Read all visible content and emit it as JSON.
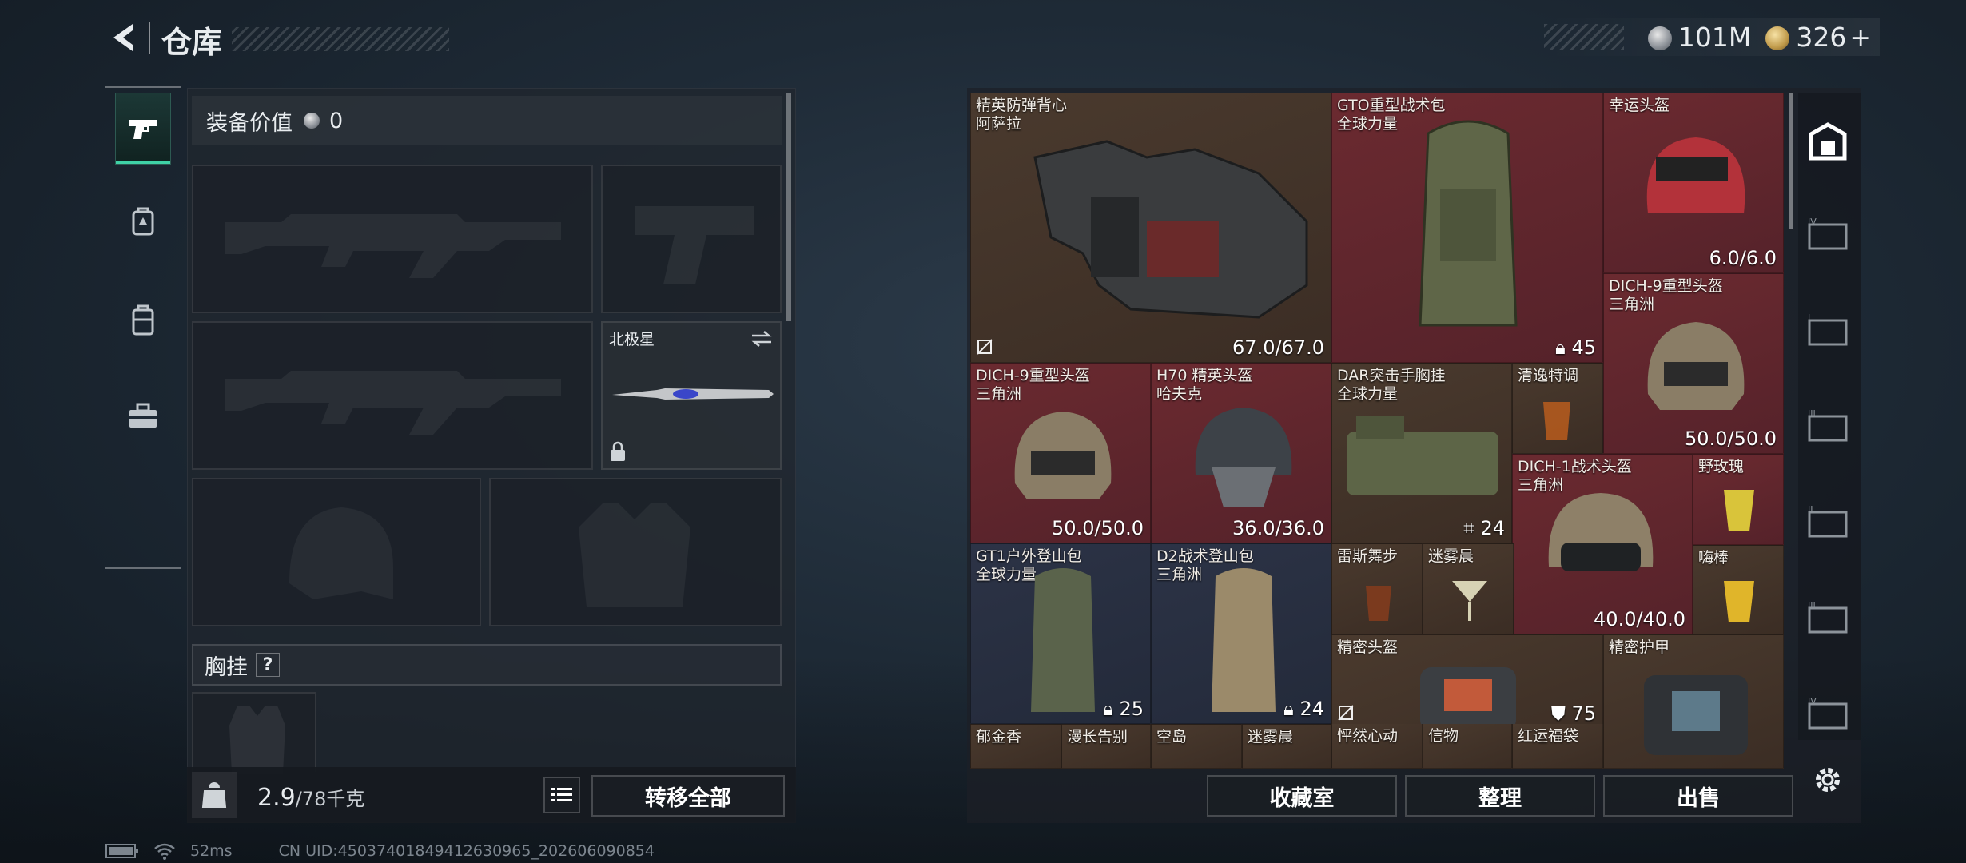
{
  "header": {
    "title": "仓库",
    "back_icon": "back-arrow-icon"
  },
  "currency": {
    "silver_amount": "101M",
    "gold_amount": "326",
    "gold_plus": "+",
    "silver_icon": "silver-coin-icon",
    "gold_icon": "gold-coin-icon"
  },
  "left_nav": {
    "items": [
      "pistol-icon",
      "backpack-icon",
      "armor-icon",
      "toolbox-icon"
    ],
    "active_index": 0
  },
  "loadout": {
    "equip_value_label": "装备价值",
    "equip_value": "0",
    "melee_name": "北极星",
    "chest_rig_label": "胸挂",
    "chest_rig_help": "?"
  },
  "footer_left": {
    "weight": "2.9",
    "weight_max": "/78千克",
    "transfer_all": "转移全部"
  },
  "items": [
    {
      "name": "精英防弹背心",
      "sub": "阿萨拉",
      "value": "67.0/67.0",
      "color": "brown"
    },
    {
      "name": "GTO重型战术包",
      "sub": "全球力量",
      "value": "45",
      "color": "red"
    },
    {
      "name": "幸运头盔",
      "sub": "",
      "value": "6.0/6.0",
      "color": "red"
    },
    {
      "name": "DICH-9重型头盔",
      "sub": "三角洲",
      "value": "50.0/50.0",
      "color": "red"
    },
    {
      "name": "DICH-9重型头盔",
      "sub": "三角洲",
      "value": "50.0/50.0",
      "color": "red"
    },
    {
      "name": "H70 精英头盔",
      "sub": "哈夫克",
      "value": "36.0/36.0",
      "color": "red"
    },
    {
      "name": "DAR突击手胸挂",
      "sub": "全球力量",
      "value": "24",
      "color": "brown"
    },
    {
      "name": "清逸特调",
      "sub": "",
      "value": "",
      "color": "brown"
    },
    {
      "name": "DICH-1战术头盔",
      "sub": "三角洲",
      "value": "40.0/40.0",
      "color": "red"
    },
    {
      "name": "野玫瑰",
      "sub": "",
      "value": "",
      "color": "red"
    },
    {
      "name": "GT1户外登山包",
      "sub": "全球力量",
      "value": "25",
      "color": "blue"
    },
    {
      "name": "D2战术登山包",
      "sub": "三角洲",
      "value": "24",
      "color": "blue"
    },
    {
      "name": "雷斯舞步",
      "sub": "",
      "value": "",
      "color": "brown"
    },
    {
      "name": "迷雾晨",
      "sub": "",
      "value": "",
      "color": "brown"
    },
    {
      "name": "嗨棒",
      "sub": "",
      "value": "",
      "color": "brown"
    },
    {
      "name": "精密头盔",
      "sub": "",
      "value": "75",
      "color": "brown"
    },
    {
      "name": "精密护甲",
      "sub": "",
      "value": "",
      "color": "brown"
    },
    {
      "name": "郁金香",
      "sub": "",
      "value": "",
      "color": "brown"
    },
    {
      "name": "漫长告别",
      "sub": "",
      "value": "",
      "color": "brown"
    },
    {
      "name": "空岛",
      "sub": "",
      "value": "",
      "color": "brown"
    },
    {
      "name": "迷雾晨",
      "sub": "",
      "value": "",
      "color": "brown"
    },
    {
      "name": "怦然心动",
      "sub": "",
      "value": "",
      "color": "brown"
    },
    {
      "name": "信物",
      "sub": "",
      "value": "",
      "color": "brown"
    },
    {
      "name": "红运福袋",
      "sub": "",
      "value": "",
      "color": "brown"
    }
  ],
  "footer_right": {
    "collection": "收藏室",
    "sort": "整理",
    "sell": "出售"
  },
  "right_nav": {
    "items": [
      "safe-icon",
      "storage-tab-4-icon",
      "storage-tab-icon",
      "storage-tab-3-icon",
      "storage-tab-2-icon",
      "storage-tab-3b-icon",
      "storage-tab-4b-icon"
    ],
    "settings_icon": "gear-icon"
  },
  "status": {
    "ping": "52ms",
    "uid": "CN UID:4503740184941263096​5_202606090854"
  }
}
